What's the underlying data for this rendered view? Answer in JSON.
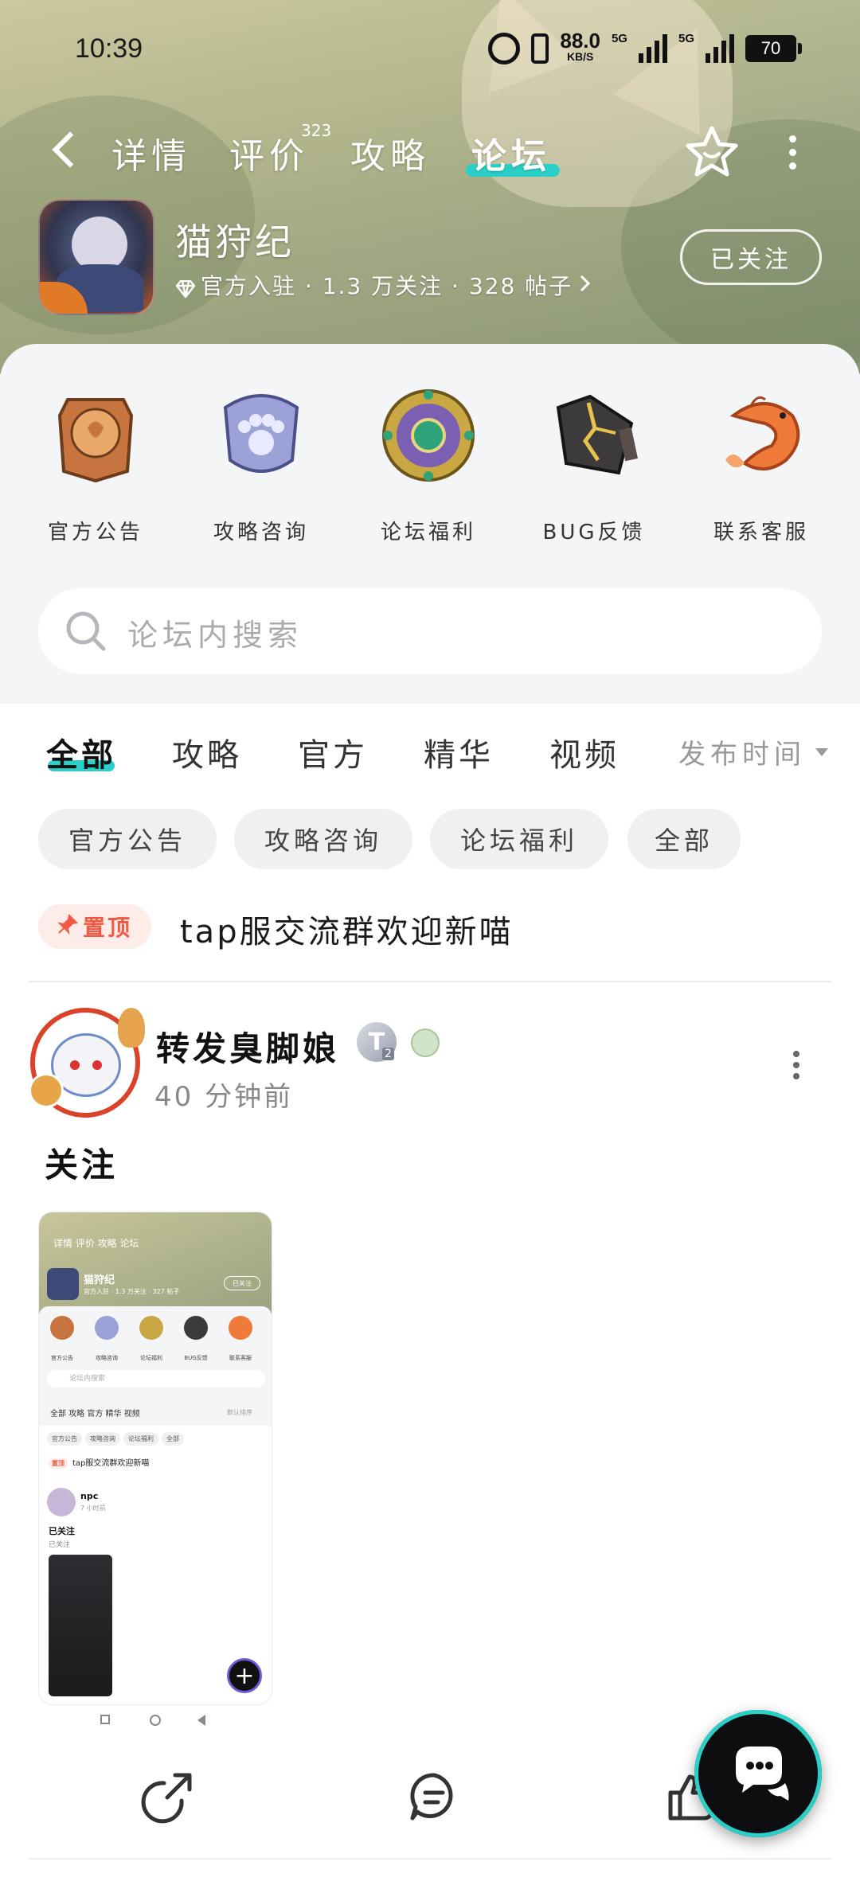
{
  "status_bar": {
    "time": "10:39",
    "speed_value": "88.0",
    "speed_unit": "KB/S",
    "net1": "5G",
    "net2": "5G",
    "battery": "70"
  },
  "header": {
    "tabs": [
      {
        "label": "详情"
      },
      {
        "label": "评价",
        "count": "323"
      },
      {
        "label": "攻略"
      },
      {
        "label": "论坛",
        "active": true
      }
    ]
  },
  "game": {
    "name": "猫狩纪",
    "meta": "官方入驻 · 1.3 万关注 · 328 帖子",
    "follow_label": "已关注"
  },
  "quick_links": [
    {
      "label": "官方公告",
      "icon": "announcement-icon"
    },
    {
      "label": "攻略咨询",
      "icon": "paw-shield-icon"
    },
    {
      "label": "论坛福利",
      "icon": "gem-medallion-icon"
    },
    {
      "label": "BUG反馈",
      "icon": "cracked-stone-icon"
    },
    {
      "label": "联系客服",
      "icon": "koi-fish-icon"
    }
  ],
  "search": {
    "placeholder": "论坛内搜索"
  },
  "filter_tabs": [
    {
      "label": "全部",
      "active": true
    },
    {
      "label": "攻略"
    },
    {
      "label": "官方"
    },
    {
      "label": "精华"
    },
    {
      "label": "视频"
    }
  ],
  "sort_label": "发布时间",
  "chips": [
    {
      "label": "官方公告"
    },
    {
      "label": "攻略咨询"
    },
    {
      "label": "论坛福利"
    },
    {
      "label": "全部"
    }
  ],
  "pinned": {
    "badge": "置顶",
    "text": "tap服交流群欢迎新喵"
  },
  "post": {
    "author": "转发臭脚娘",
    "level": "T",
    "level_sub": "2",
    "time": "40 分钟前",
    "title": "关注"
  },
  "thumbnail": {
    "tabs": "详情  评价  攻略  论坛",
    "name": "猫狩纪",
    "meta": "官方入驻 · 1.3 万关注 · 327 帖子",
    "follow": "已关注",
    "quick": [
      "官方公告",
      "攻略咨询",
      "论坛福利",
      "BUG反馈",
      "联系客服"
    ],
    "search": "论坛内搜索",
    "filter": "全部  攻略  官方  精华  视频",
    "sort": "默认排序",
    "chips": [
      "官方公告",
      "攻略咨询",
      "论坛福利",
      "全部"
    ],
    "pin_badge": "置顶",
    "pin_text": "tap服交流群欢迎新喵",
    "author": "npc",
    "ago": "7 小时前",
    "title": "已关注",
    "sub": "已关注",
    "plus": "+"
  },
  "colors": {
    "accent": "#2ad0c8",
    "pin": "#f05a44",
    "fab_ring": "#6a5bd6"
  }
}
